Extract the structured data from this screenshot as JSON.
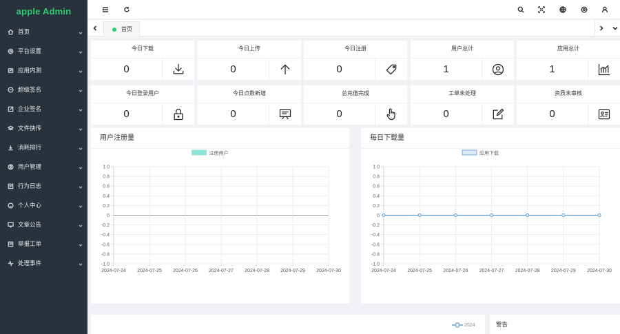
{
  "app": {
    "title": "apple Admin",
    "accent": "#2ecc71"
  },
  "sidebar": {
    "items": [
      {
        "label": "首页",
        "icon": "home-icon"
      },
      {
        "label": "平台设置",
        "icon": "gear-icon"
      },
      {
        "label": "应用内测",
        "icon": "app-test-icon"
      },
      {
        "label": "超级签名",
        "icon": "signature-icon"
      },
      {
        "label": "企业签名",
        "icon": "edit-icon"
      },
      {
        "label": "文件快传",
        "icon": "layers-icon"
      },
      {
        "label": "消耗排行",
        "icon": "download-icon"
      },
      {
        "label": "用户管理",
        "icon": "user-circle-icon"
      },
      {
        "label": "行为日志",
        "icon": "log-icon"
      },
      {
        "label": "个人中心",
        "icon": "smile-icon"
      },
      {
        "label": "文章公告",
        "icon": "monitor-icon"
      },
      {
        "label": "举报工单",
        "icon": "ticket-icon"
      },
      {
        "label": "处理事件",
        "icon": "pulse-icon"
      }
    ]
  },
  "tabs": {
    "home": "首页"
  },
  "cards": [
    {
      "title": "今日下载",
      "value": "0",
      "icon": "download-tray-icon"
    },
    {
      "title": "今日上传",
      "value": "0",
      "icon": "arrow-up-icon"
    },
    {
      "title": "今日注册",
      "value": "0",
      "icon": "tag-icon"
    },
    {
      "title": "用户总计",
      "value": "1",
      "icon": "user-circle-icon"
    },
    {
      "title": "应用总计",
      "value": "1",
      "icon": "bar-chart-icon"
    },
    {
      "title": "今日登录用户",
      "value": "0",
      "icon": "lock-icon"
    },
    {
      "title": "今日点数新增",
      "value": "0",
      "icon": "presentation-icon"
    },
    {
      "title": "总充值完成",
      "value": "0",
      "icon": "hand-pointer-icon"
    },
    {
      "title": "工单未处理",
      "value": "0",
      "icon": "edit-square-icon"
    },
    {
      "title": "资质未审核",
      "value": "0",
      "icon": "id-card-icon"
    }
  ],
  "panels": {
    "register_title": "用户注册量",
    "download_title": "每日下载量",
    "bottom_legend": "2024",
    "warning_title": "警告"
  },
  "chart_data": [
    {
      "type": "line",
      "title": "用户注册量",
      "categories": [
        "2024-07-24",
        "2024-07-25",
        "2024-07-26",
        "2024-07-27",
        "2024-07-28",
        "2024-07-29",
        "2024-07-30"
      ],
      "series": [
        {
          "name": "注册用户",
          "values": [],
          "color": "#8fe0d6"
        }
      ],
      "ylim": [
        -1.0,
        1.0
      ],
      "yticks": [
        "1.0",
        "0.8",
        "0.6",
        "0.4",
        "0.2",
        "0",
        "-0.2",
        "-0.4",
        "-0.6",
        "-0.8",
        "-1.0"
      ],
      "grid": true,
      "legend": "top-center"
    },
    {
      "type": "line",
      "title": "每日下载量",
      "categories": [
        "2024-07-24",
        "2024-07-25",
        "2024-07-26",
        "2024-07-27",
        "2024-07-28",
        "2024-07-29",
        "2024-07-30"
      ],
      "series": [
        {
          "name": "应用下载",
          "values": [
            0,
            0,
            0,
            0,
            0,
            0,
            0
          ],
          "color": "#5b9bd5"
        }
      ],
      "ylim": [
        -1.0,
        1.0
      ],
      "yticks": [
        "1.0",
        "0.8",
        "0.6",
        "0.4",
        "0.2",
        "0",
        "-0.2",
        "-0.4",
        "-0.6",
        "-0.8",
        "-1.0"
      ],
      "grid": true,
      "legend": "top-center"
    }
  ]
}
